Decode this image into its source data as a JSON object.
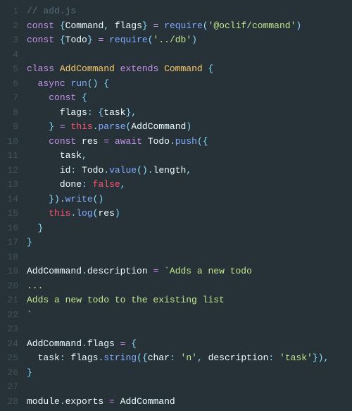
{
  "language": "javascript",
  "filename_comment": "add.js",
  "lines": [
    {
      "n": 1,
      "tokens": [
        [
          "c-comment",
          "// add.js"
        ]
      ]
    },
    {
      "n": 2,
      "tokens": [
        [
          "c-kw",
          "const"
        ],
        [
          "",
          " "
        ],
        [
          "c-punct",
          "{"
        ],
        [
          "c-ident",
          "Command"
        ],
        [
          "c-punct",
          ","
        ],
        [
          "",
          " "
        ],
        [
          "c-ident",
          "flags"
        ],
        [
          "c-punct",
          "}"
        ],
        [
          "",
          " "
        ],
        [
          "c-op",
          "="
        ],
        [
          "",
          " "
        ],
        [
          "c-func",
          "require"
        ],
        [
          "c-punct",
          "("
        ],
        [
          "c-str",
          "'@oclif/command'"
        ],
        [
          "c-punct",
          ")"
        ]
      ]
    },
    {
      "n": 3,
      "tokens": [
        [
          "c-kw",
          "const"
        ],
        [
          "",
          " "
        ],
        [
          "c-punct",
          "{"
        ],
        [
          "c-ident",
          "Todo"
        ],
        [
          "c-punct",
          "}"
        ],
        [
          "",
          " "
        ],
        [
          "c-op",
          "="
        ],
        [
          "",
          " "
        ],
        [
          "c-func",
          "require"
        ],
        [
          "c-punct",
          "("
        ],
        [
          "c-str",
          "'../db'"
        ],
        [
          "c-punct",
          ")"
        ]
      ]
    },
    {
      "n": 4,
      "tokens": []
    },
    {
      "n": 5,
      "tokens": [
        [
          "c-kw",
          "class"
        ],
        [
          "",
          " "
        ],
        [
          "c-type",
          "AddCommand"
        ],
        [
          "",
          " "
        ],
        [
          "c-kw",
          "extends"
        ],
        [
          "",
          " "
        ],
        [
          "c-type",
          "Command"
        ],
        [
          "",
          " "
        ],
        [
          "c-punct",
          "{"
        ]
      ]
    },
    {
      "n": 6,
      "tokens": [
        [
          "",
          "  "
        ],
        [
          "c-kw",
          "async"
        ],
        [
          "",
          " "
        ],
        [
          "c-func",
          "run"
        ],
        [
          "c-punct",
          "()"
        ],
        [
          "",
          " "
        ],
        [
          "c-punct",
          "{"
        ]
      ]
    },
    {
      "n": 7,
      "tokens": [
        [
          "",
          "    "
        ],
        [
          "c-kw",
          "const"
        ],
        [
          "",
          " "
        ],
        [
          "c-punct",
          "{"
        ]
      ]
    },
    {
      "n": 8,
      "tokens": [
        [
          "",
          "      "
        ],
        [
          "c-ident",
          "flags"
        ],
        [
          "c-punct",
          ":"
        ],
        [
          "",
          " "
        ],
        [
          "c-punct",
          "{"
        ],
        [
          "c-ident",
          "task"
        ],
        [
          "c-punct",
          "}"
        ],
        [
          "c-punct",
          ","
        ]
      ]
    },
    {
      "n": 9,
      "tokens": [
        [
          "",
          "    "
        ],
        [
          "c-punct",
          "}"
        ],
        [
          "",
          " "
        ],
        [
          "c-op",
          "="
        ],
        [
          "",
          " "
        ],
        [
          "c-this",
          "this"
        ],
        [
          "c-punct",
          "."
        ],
        [
          "c-func",
          "parse"
        ],
        [
          "c-punct",
          "("
        ],
        [
          "c-ident",
          "AddCommand"
        ],
        [
          "c-punct",
          ")"
        ]
      ]
    },
    {
      "n": 10,
      "tokens": [
        [
          "",
          "    "
        ],
        [
          "c-kw",
          "const"
        ],
        [
          "",
          " "
        ],
        [
          "c-ident",
          "res"
        ],
        [
          "",
          " "
        ],
        [
          "c-op",
          "="
        ],
        [
          "",
          " "
        ],
        [
          "c-kw",
          "await"
        ],
        [
          "",
          " "
        ],
        [
          "c-ident",
          "Todo"
        ],
        [
          "c-punct",
          "."
        ],
        [
          "c-func",
          "push"
        ],
        [
          "c-punct",
          "({"
        ]
      ]
    },
    {
      "n": 11,
      "tokens": [
        [
          "",
          "      "
        ],
        [
          "c-ident",
          "task"
        ],
        [
          "c-punct",
          ","
        ]
      ]
    },
    {
      "n": 12,
      "tokens": [
        [
          "",
          "      "
        ],
        [
          "c-ident",
          "id"
        ],
        [
          "c-punct",
          ":"
        ],
        [
          "",
          " "
        ],
        [
          "c-ident",
          "Todo"
        ],
        [
          "c-punct",
          "."
        ],
        [
          "c-func",
          "value"
        ],
        [
          "c-punct",
          "()"
        ],
        [
          "c-punct",
          "."
        ],
        [
          "c-ident",
          "length"
        ],
        [
          "c-punct",
          ","
        ]
      ]
    },
    {
      "n": 13,
      "tokens": [
        [
          "",
          "      "
        ],
        [
          "c-ident",
          "done"
        ],
        [
          "c-punct",
          ":"
        ],
        [
          "",
          " "
        ],
        [
          "c-lit",
          "false"
        ],
        [
          "c-punct",
          ","
        ]
      ]
    },
    {
      "n": 14,
      "tokens": [
        [
          "",
          "    "
        ],
        [
          "c-punct",
          "})"
        ],
        [
          "c-punct",
          "."
        ],
        [
          "c-func",
          "write"
        ],
        [
          "c-punct",
          "()"
        ]
      ]
    },
    {
      "n": 15,
      "tokens": [
        [
          "",
          "    "
        ],
        [
          "c-this",
          "this"
        ],
        [
          "c-punct",
          "."
        ],
        [
          "c-func",
          "log"
        ],
        [
          "c-punct",
          "("
        ],
        [
          "c-ident",
          "res"
        ],
        [
          "c-punct",
          ")"
        ]
      ]
    },
    {
      "n": 16,
      "tokens": [
        [
          "",
          "  "
        ],
        [
          "c-punct",
          "}"
        ]
      ]
    },
    {
      "n": 17,
      "tokens": [
        [
          "c-punct",
          "}"
        ]
      ]
    },
    {
      "n": 18,
      "tokens": []
    },
    {
      "n": 19,
      "tokens": [
        [
          "c-ident",
          "AddCommand"
        ],
        [
          "c-punct",
          "."
        ],
        [
          "c-ident",
          "description"
        ],
        [
          "",
          " "
        ],
        [
          "c-op",
          "="
        ],
        [
          "",
          " "
        ],
        [
          "c-str",
          "`Adds a new todo"
        ]
      ]
    },
    {
      "n": 20,
      "tokens": [
        [
          "c-str",
          "..."
        ]
      ]
    },
    {
      "n": 21,
      "tokens": [
        [
          "c-str",
          "Adds a new todo to the existing list"
        ]
      ]
    },
    {
      "n": 22,
      "tokens": [
        [
          "c-str",
          "`"
        ]
      ]
    },
    {
      "n": 23,
      "tokens": []
    },
    {
      "n": 24,
      "tokens": [
        [
          "c-ident",
          "AddCommand"
        ],
        [
          "c-punct",
          "."
        ],
        [
          "c-ident",
          "flags"
        ],
        [
          "",
          " "
        ],
        [
          "c-op",
          "="
        ],
        [
          "",
          " "
        ],
        [
          "c-punct",
          "{"
        ]
      ]
    },
    {
      "n": 25,
      "tokens": [
        [
          "",
          "  "
        ],
        [
          "c-ident",
          "task"
        ],
        [
          "c-punct",
          ":"
        ],
        [
          "",
          " "
        ],
        [
          "c-ident",
          "flags"
        ],
        [
          "c-punct",
          "."
        ],
        [
          "c-func",
          "string"
        ],
        [
          "c-punct",
          "({"
        ],
        [
          "c-ident",
          "char"
        ],
        [
          "c-punct",
          ":"
        ],
        [
          "",
          " "
        ],
        [
          "c-str",
          "'n'"
        ],
        [
          "c-punct",
          ","
        ],
        [
          "",
          " "
        ],
        [
          "c-ident",
          "description"
        ],
        [
          "c-punct",
          ":"
        ],
        [
          "",
          " "
        ],
        [
          "c-str",
          "'task'"
        ],
        [
          "c-punct",
          "}),"
        ]
      ]
    },
    {
      "n": 26,
      "tokens": [
        [
          "c-punct",
          "}"
        ]
      ]
    },
    {
      "n": 27,
      "tokens": []
    },
    {
      "n": 28,
      "tokens": [
        [
          "c-ident",
          "module"
        ],
        [
          "c-punct",
          "."
        ],
        [
          "c-ident",
          "exports"
        ],
        [
          "",
          " "
        ],
        [
          "c-op",
          "="
        ],
        [
          "",
          " "
        ],
        [
          "c-ident",
          "AddCommand"
        ]
      ]
    }
  ]
}
